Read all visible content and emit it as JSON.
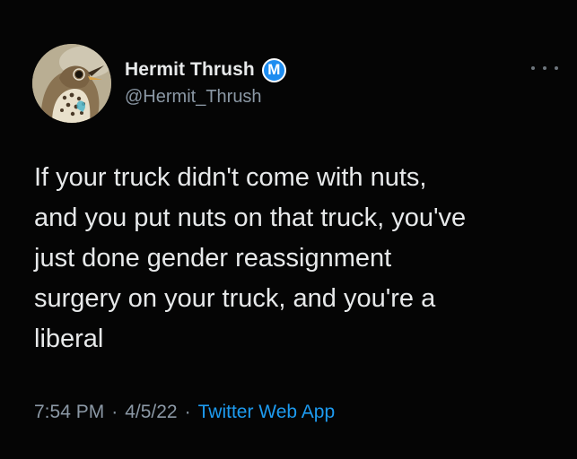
{
  "author": {
    "display_name": "Hermit Thrush",
    "handle": "@Hermit_Thrush",
    "badge_letter": "M",
    "badge_color": "#1d8cf0",
    "avatar_icon": "hermit-thrush-bird-icon"
  },
  "menu": {
    "icon": "more-horizontal-icon"
  },
  "tweet": {
    "text": "If your truck didn't come with nuts,\nand you put nuts on that truck, you've\njust done gender reassignment\nsurgery on your truck, and you're a\nliberal"
  },
  "meta": {
    "time": "7:54 PM",
    "separator": "·",
    "date": "4/5/22",
    "source": "Twitter Web App",
    "source_color": "#1d9bf0"
  },
  "theme": {
    "background": "#050505",
    "text": "#e7e9ea",
    "secondary_text": "#8b98a5"
  }
}
